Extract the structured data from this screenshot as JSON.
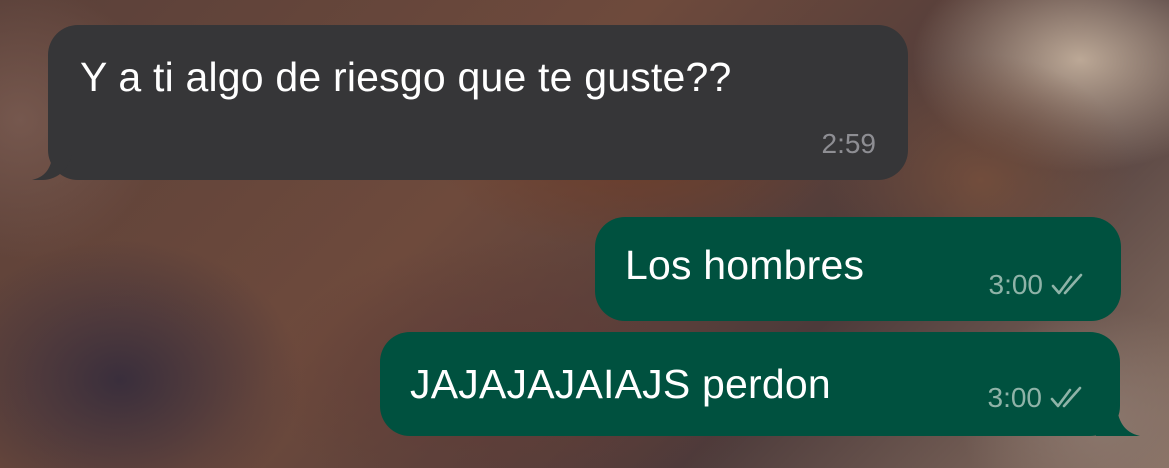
{
  "chat": {
    "messages": [
      {
        "direction": "incoming",
        "text": "Y a ti algo de riesgo que te guste??",
        "time": "2:59",
        "receipt_icon": ""
      },
      {
        "direction": "outgoing",
        "text": "Los hombres",
        "time": "3:00",
        "receipt_icon": "double-check-icon"
      },
      {
        "direction": "outgoing",
        "text": "JAJAJAJAIAJS perdon",
        "time": "3:00",
        "receipt_icon": "double-check-icon"
      }
    ]
  },
  "colors": {
    "incoming_bubble": "#363638",
    "outgoing_bubble": "#00513f",
    "message_text": "#ffffff",
    "incoming_time": "#8e8e93",
    "outgoing_time": "#8fb3a8"
  }
}
